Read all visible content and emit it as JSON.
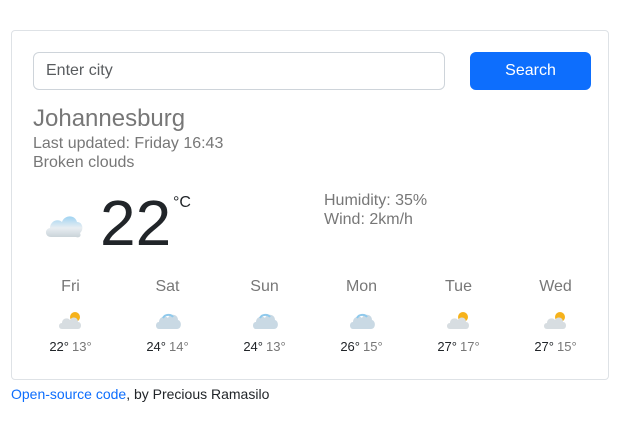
{
  "search": {
    "placeholder": "Enter city",
    "value": "",
    "button_label": "Search"
  },
  "current": {
    "city": "Johannesburg",
    "last_updated": "Last updated: Friday 16:43",
    "description": "Broken clouds",
    "icon": "cloud-icon",
    "temperature": "22",
    "unit": "°C",
    "humidity": "Humidity: 35%",
    "wind": "Wind: 2km/h"
  },
  "forecast": [
    {
      "day": "Fri",
      "icon": "partly-cloudy-icon",
      "max": "22°",
      "min": "13°"
    },
    {
      "day": "Sat",
      "icon": "cloud-icon",
      "max": "24°",
      "min": "14°"
    },
    {
      "day": "Sun",
      "icon": "cloud-icon",
      "max": "24°",
      "min": "13°"
    },
    {
      "day": "Mon",
      "icon": "cloud-icon",
      "max": "26°",
      "min": "15°"
    },
    {
      "day": "Tue",
      "icon": "partly-cloudy-icon",
      "max": "27°",
      "min": "17°"
    },
    {
      "day": "Wed",
      "icon": "partly-cloudy-icon",
      "max": "27°",
      "min": "15°"
    }
  ],
  "footer": {
    "link_text": "Open-source code",
    "suffix": ", by Precious Ramasilo"
  },
  "colors": {
    "accent": "#0d6efd",
    "muted_text": "#777777",
    "sun": "#f6b21b",
    "cloud": "#8fc9ec"
  }
}
